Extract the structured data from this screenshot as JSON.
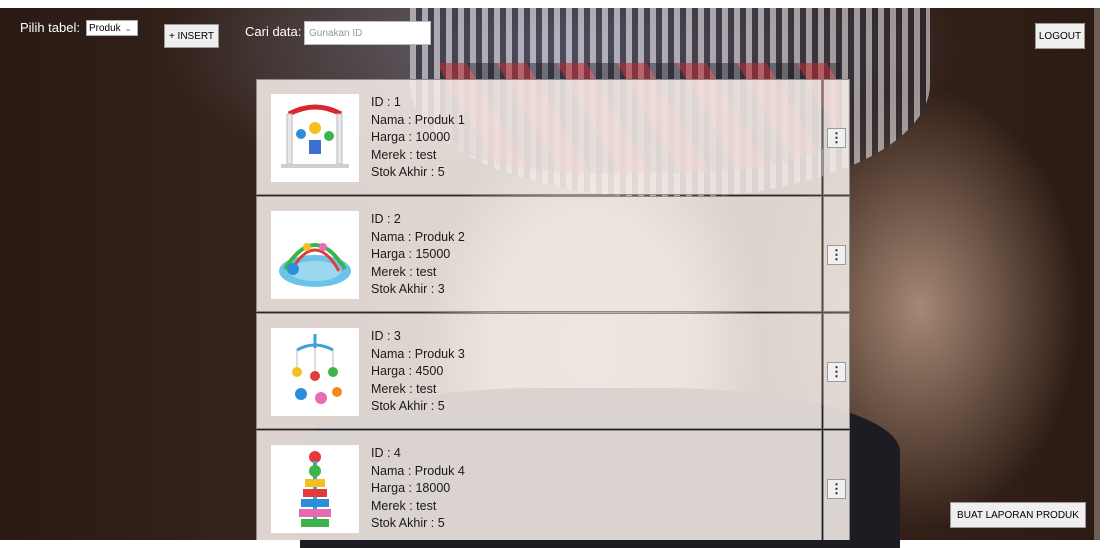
{
  "toolbar": {
    "table_label": "Pilih tabel:",
    "table_selected": "Produk",
    "insert_label": "+ INSERT",
    "search_label": "Cari data:",
    "search_placeholder": "Gunakan ID",
    "search_value": "",
    "logout_label": "LOGOUT"
  },
  "products": [
    {
      "id": "ID : 1",
      "name": "Nama : Produk 1",
      "price": "Harga : 10000",
      "brand": "Merek : test",
      "stock": "Stok Akhir : 5",
      "image": "baby-gym-toy"
    },
    {
      "id": "ID : 2",
      "name": "Nama : Produk 2",
      "price": "Harga : 15000",
      "brand": "Merek : test",
      "stock": "Stok Akhir : 3",
      "image": "play-mat-toy"
    },
    {
      "id": "ID : 3",
      "name": "Nama : Produk 3",
      "price": "Harga : 4500",
      "brand": "Merek : test",
      "stock": "Stok Akhir : 5",
      "image": "crib-mobile-toy"
    },
    {
      "id": "ID : 4",
      "name": "Nama : Produk 4",
      "price": "Harga : 18000",
      "brand": "Merek : test",
      "stock": "Stok Akhir : 5",
      "image": "stacking-toy"
    }
  ],
  "row_menu_icon": "kebab-menu-icon",
  "report_label": "BUAT LAPORAN PRODUK"
}
